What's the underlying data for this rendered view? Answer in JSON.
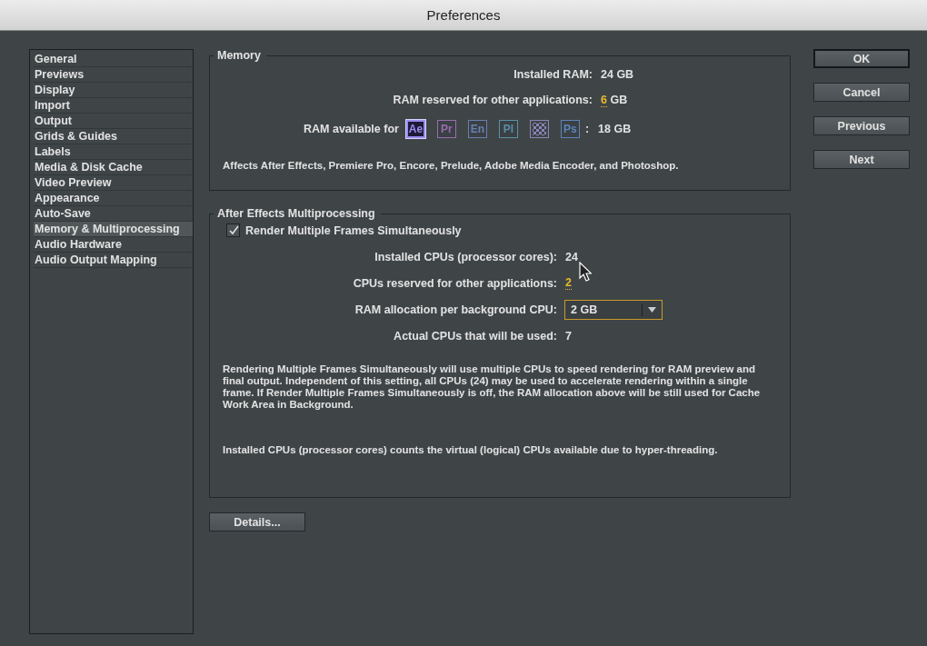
{
  "window": {
    "title": "Preferences"
  },
  "sidebar": {
    "items": [
      {
        "label": "General",
        "selected": false
      },
      {
        "label": "Previews",
        "selected": false
      },
      {
        "label": "Display",
        "selected": false
      },
      {
        "label": "Import",
        "selected": false
      },
      {
        "label": "Output",
        "selected": false
      },
      {
        "label": "Grids & Guides",
        "selected": false
      },
      {
        "label": "Labels",
        "selected": false
      },
      {
        "label": "Media & Disk Cache",
        "selected": false
      },
      {
        "label": "Video Preview",
        "selected": false
      },
      {
        "label": "Appearance",
        "selected": false
      },
      {
        "label": "Auto-Save",
        "selected": false
      },
      {
        "label": "Memory & Multiprocessing",
        "selected": true
      },
      {
        "label": "Audio Hardware",
        "selected": false
      },
      {
        "label": "Audio Output Mapping",
        "selected": false
      }
    ]
  },
  "memory": {
    "title": "Memory",
    "rows": [
      {
        "label": "Installed RAM:",
        "value": "24 GB",
        "kind": "static"
      },
      {
        "label": "RAM reserved for other applications:",
        "value": "6",
        "unit": "GB",
        "kind": "editable"
      }
    ],
    "apps_row": {
      "label": "RAM available for",
      "separator": ":",
      "value": "18 GB",
      "apps": [
        {
          "abbr": "Ae",
          "color": "#9a8cf0",
          "selected": true
        },
        {
          "abbr": "Pr",
          "color": "#9b6bb0",
          "selected": false
        },
        {
          "abbr": "En",
          "color": "#6a7fb0",
          "selected": false
        },
        {
          "abbr": "Pl",
          "color": "#5a90a8",
          "selected": false
        },
        {
          "kind": "encoder",
          "color": "#8c84b8",
          "selected": false
        },
        {
          "abbr": "Ps",
          "color": "#5e84b8",
          "selected": false
        }
      ]
    },
    "note": "Affects After Effects, Premiere Pro, Encore, Prelude, Adobe Media Encoder, and Photoshop."
  },
  "multiprocessing": {
    "title": "After Effects Multiprocessing",
    "checkbox": {
      "label": "Render Multiple Frames Simultaneously",
      "checked": true
    },
    "rows": [
      {
        "label": "Installed CPUs (processor cores):",
        "value": "24",
        "kind": "static"
      },
      {
        "label": "CPUs reserved for other applications:",
        "value": "2",
        "kind": "editable"
      },
      {
        "label": "RAM allocation per background CPU:",
        "value": "2 GB",
        "kind": "dropdown"
      },
      {
        "label": "Actual CPUs that will be used:",
        "value": "7",
        "kind": "static"
      }
    ],
    "notes": [
      "Rendering Multiple Frames Simultaneously will use multiple CPUs to speed rendering for RAM preview and final output. Independent of this setting, all CPUs (24) may be used to accelerate rendering within a single frame. If Render Multiple Frames Simultaneously is off, the RAM allocation above will be still used for Cache Work Area in Background.",
      "Installed CPUs (processor cores) counts the virtual (logical) CPUs available due to hyper-threading."
    ]
  },
  "details_button": "Details...",
  "buttons": [
    {
      "label": "OK",
      "default": true
    },
    {
      "label": "Cancel",
      "default": false
    },
    {
      "label": "Previous",
      "default": false
    },
    {
      "label": "Next",
      "default": false
    }
  ]
}
